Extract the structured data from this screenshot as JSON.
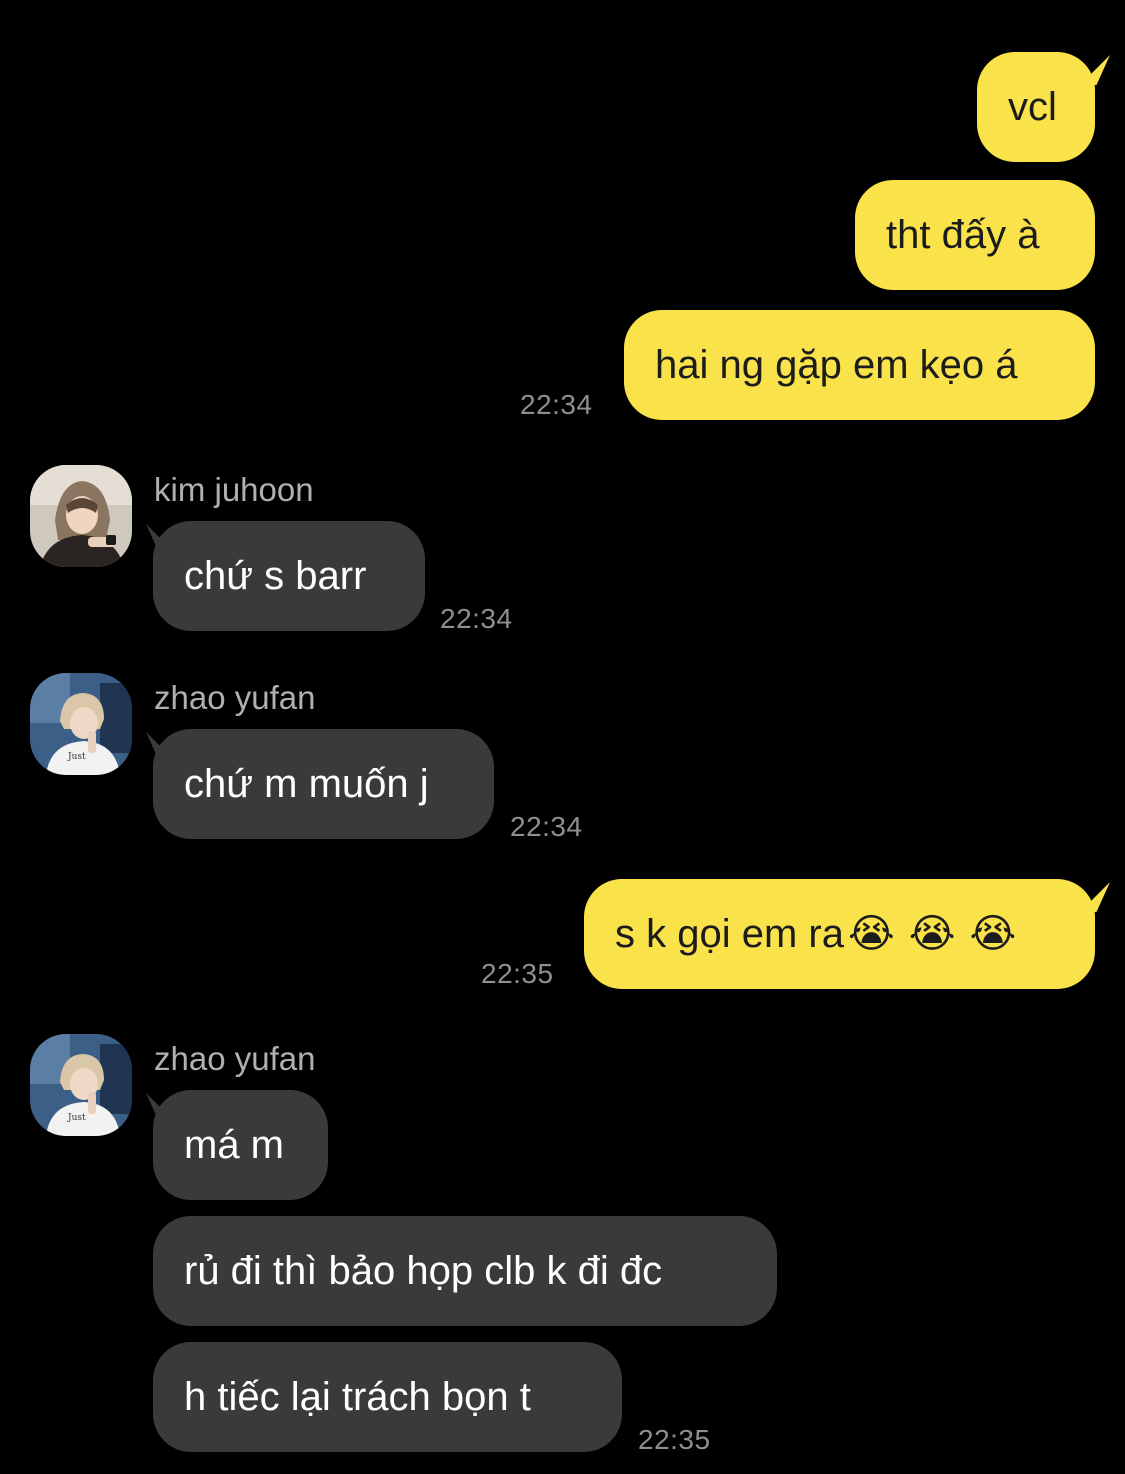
{
  "colors": {
    "background": "#000000",
    "outgoing_bubble": "#f9e24a",
    "incoming_bubble": "#3a3a3c",
    "timestamp": "#8e8e93",
    "sender_name": "#b0b0b0"
  },
  "outgoing_1": {
    "messages": [
      "vcl",
      "tht đấy à",
      "hai ng gặp em kẹo á"
    ],
    "time": "22:34"
  },
  "incoming_1": {
    "sender": "kim juhoon",
    "avatar_icon": "profile-photo-kim-juhoon",
    "messages": [
      "chứ s barr"
    ],
    "time": "22:34"
  },
  "incoming_2": {
    "sender": "zhao yufan",
    "avatar_icon": "profile-photo-zhao-yufan",
    "messages": [
      "chứ m muốn j"
    ],
    "time": "22:34"
  },
  "outgoing_2": {
    "messages": [
      "s k gọi em ra"
    ],
    "emojis": [
      "😭",
      "😭",
      "😭"
    ],
    "emoji_name": "loudly-crying-face-icon",
    "time": "22:35"
  },
  "incoming_3": {
    "sender": "zhao yufan",
    "avatar_icon": "profile-photo-zhao-yufan",
    "messages": [
      "má m",
      "rủ đi thì bảo họp clb k đi đc",
      "h tiếc lại trách bọn t"
    ],
    "time": "22:35"
  }
}
